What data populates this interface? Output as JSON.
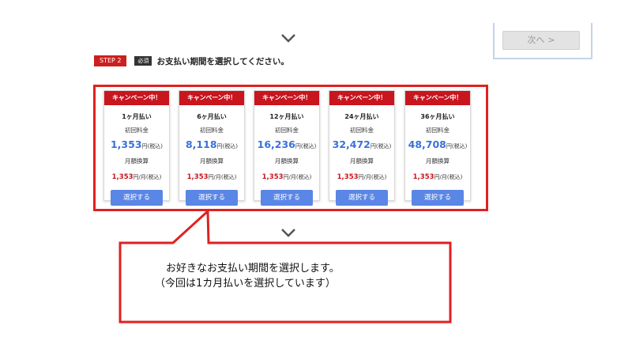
{
  "next_panel": {
    "button_label": "次へ",
    "arrow": ">"
  },
  "step": {
    "badge": "STEP 2",
    "required": "必須",
    "instruction": "お支払い期間を選択してください。"
  },
  "plans": [
    {
      "ribbon": "キャンペーン中！",
      "period": "1ヶ月払い",
      "initial_label": "初回料金",
      "initial_price": "1,353",
      "initial_unit": "円(税込)",
      "monthly_label": "月額換算",
      "monthly_price": "1,353",
      "monthly_unit": "円/月(税込)",
      "button": "選択する"
    },
    {
      "ribbon": "キャンペーン中！",
      "period": "6ヶ月払い",
      "initial_label": "初回料金",
      "initial_price": "8,118",
      "initial_unit": "円(税込)",
      "monthly_label": "月額換算",
      "monthly_price": "1,353",
      "monthly_unit": "円/月(税込)",
      "button": "選択する"
    },
    {
      "ribbon": "キャンペーン中！",
      "period": "12ヶ月払い",
      "initial_label": "初回料金",
      "initial_price": "16,236",
      "initial_unit": "円(税込)",
      "monthly_label": "月額換算",
      "monthly_price": "1,353",
      "monthly_unit": "円/月(税込)",
      "button": "選択する"
    },
    {
      "ribbon": "キャンペーン中！",
      "period": "24ヶ月払い",
      "initial_label": "初回料金",
      "initial_price": "32,472",
      "initial_unit": "円(税込)",
      "monthly_label": "月額換算",
      "monthly_price": "1,353",
      "monthly_unit": "円/月(税込)",
      "button": "選択する"
    },
    {
      "ribbon": "キャンペーン中！",
      "period": "36ヶ月払い",
      "initial_label": "初回料金",
      "initial_price": "48,708",
      "initial_unit": "円(税込)",
      "monthly_label": "月額換算",
      "monthly_price": "1,353",
      "monthly_unit": "円/月(税込)",
      "button": "選択する"
    }
  ],
  "callout": {
    "line1": "お好きなお支払い期間を選択します。",
    "line2": "（今回は1カ月払いを選択しています）"
  },
  "colors": {
    "accent_red": "#e02020",
    "ribbon_red": "#c9151e",
    "price_blue": "#3a72d8",
    "button_blue": "#5a86e6"
  },
  "icons": [
    "chevron-down-icon",
    "chevron-down-icon"
  ]
}
